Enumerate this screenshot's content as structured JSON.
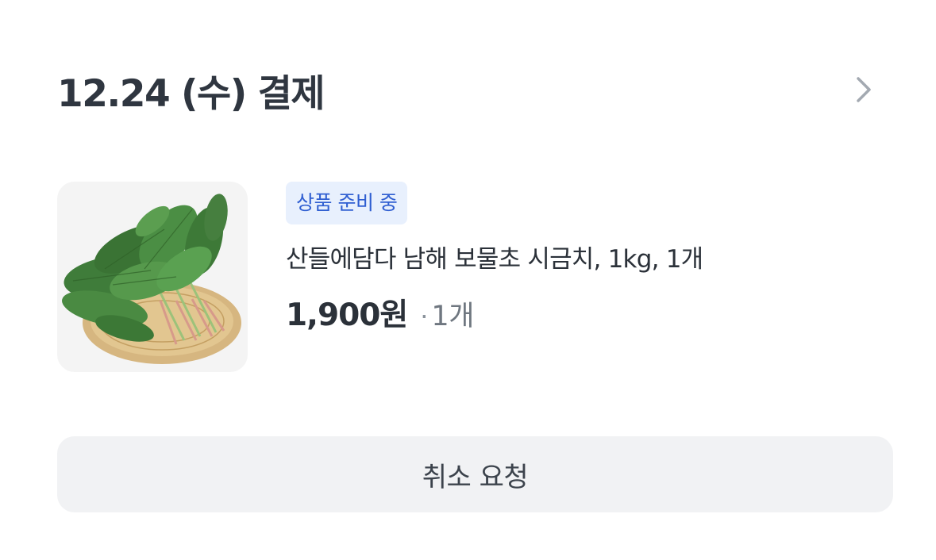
{
  "order": {
    "payment_title": "12.24 (수) 결제",
    "detail_icon": "chevron-right-icon"
  },
  "item": {
    "image": "spinach-product-image",
    "status_badge": "상품 준비 중",
    "name": "산들에담다 남해 보물초 시금치, 1kg, 1개",
    "price": "1,900원",
    "separator": "·",
    "quantity": "1개"
  },
  "actions": {
    "cancel_label": "취소 요청"
  },
  "colors": {
    "badge_bg": "#e8f0fd",
    "badge_text": "#2f5ed1",
    "button_bg": "#f1f2f4"
  }
}
